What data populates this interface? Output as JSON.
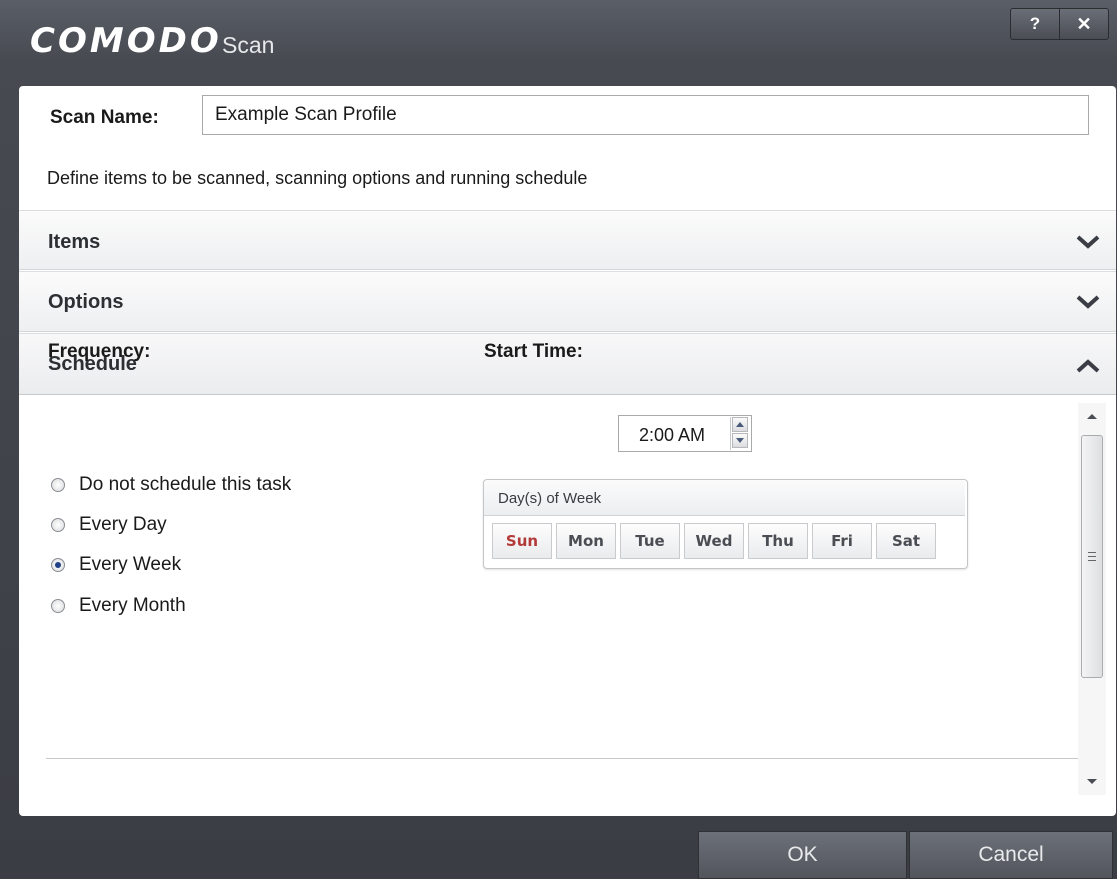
{
  "window": {
    "logo": "COMODO",
    "title": "Scan",
    "help_label": "?",
    "close_label": "✕"
  },
  "scan_name": {
    "label": "Scan Name:",
    "value": "Example Scan Profile"
  },
  "description": "Define items to be scanned, scanning options and running schedule",
  "sections": {
    "items": {
      "label": "Items",
      "state": "collapsed",
      "icon": "chevron-down-icon"
    },
    "options": {
      "label": "Options",
      "state": "collapsed",
      "icon": "chevron-down-icon"
    },
    "schedule": {
      "label": "Schedule",
      "state": "expanded",
      "icon": "chevron-up-icon"
    }
  },
  "schedule": {
    "frequency_label": "Frequency:",
    "frequency_options": [
      {
        "label": "Do not schedule this task",
        "checked": false
      },
      {
        "label": "Every Day",
        "checked": false
      },
      {
        "label": "Every Week",
        "checked": true
      },
      {
        "label": "Every Month",
        "checked": false
      }
    ],
    "start_time_label": "Start Time:",
    "start_time_value": "2:00 AM",
    "days_title": "Day(s) of Week",
    "days": [
      "Sun",
      "Mon",
      "Tue",
      "Wed",
      "Thu",
      "Fri",
      "Sat"
    ]
  },
  "footer": {
    "ok_label": "OK",
    "cancel_label": "Cancel"
  },
  "colors": {
    "accent_dark": "#3a3d43",
    "sunday_red": "#b33a3a",
    "radio_dot": "#1f3f86"
  }
}
